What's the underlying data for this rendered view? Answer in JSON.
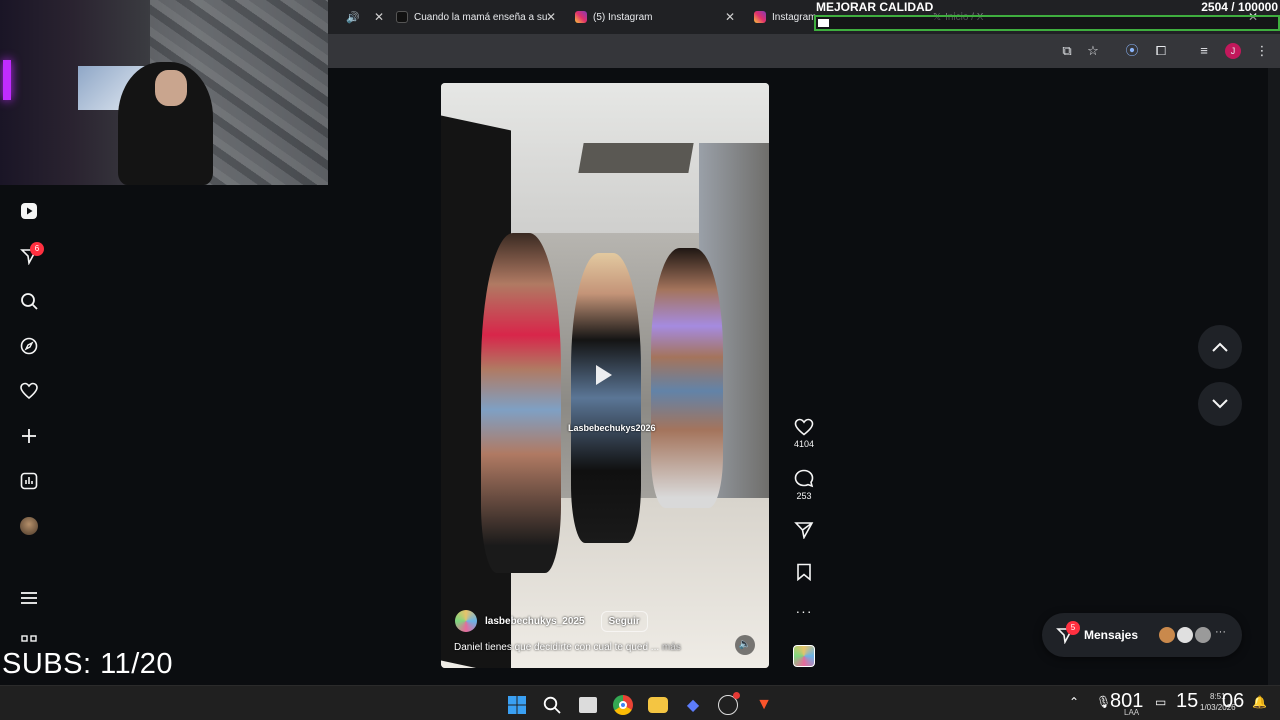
{
  "stream_overlay": {
    "quality_title": "MEJORAR CALIDAD",
    "goal_count": "2504  / 100000",
    "goal_progress": 0.025,
    "subs_text": "SUBS: 11/20"
  },
  "browser": {
    "tabs": [
      {
        "label": "",
        "active": true
      },
      {
        "label": "Cuando la mamá enseña a su",
        "icon": "tiktok-icon"
      },
      {
        "label": "(5) Instagram",
        "icon": "instagram-icon"
      },
      {
        "label": "Instagram",
        "icon": "instagram-icon"
      },
      {
        "label": "Inicio / X",
        "icon": "x-icon"
      }
    ]
  },
  "sidebar": {
    "notifications_badge": "6",
    "items": [
      {
        "name": "reels-icon"
      },
      {
        "name": "messenger-icon"
      },
      {
        "name": "search-icon"
      },
      {
        "name": "explore-icon"
      },
      {
        "name": "heart-icon"
      },
      {
        "name": "create-icon"
      },
      {
        "name": "dashboard-icon"
      },
      {
        "name": "profile-avatar"
      },
      {
        "name": "menu-icon"
      },
      {
        "name": "apps-icon"
      }
    ]
  },
  "reel": {
    "tag_text": "Lasbebechukys2026",
    "username": "lasbebechukys_2025",
    "follow_label": "Seguir",
    "caption": "Daniel tienes que decidirte con cual te qued ...",
    "caption_more": "más",
    "likes": "4104",
    "comments": "253"
  },
  "messages": {
    "label": "Mensajes",
    "badge": "5"
  },
  "taskbar": {
    "clock_big_left": "801",
    "clock_big_mid": "15",
    "clock_big_right": "06",
    "clock_small_time": "8:51",
    "clock_small_date": "1/03/2026",
    "keyboard_layout": "LAA"
  },
  "colors": {
    "accent_green": "#3fae3f",
    "badge_red": "#ff3040",
    "page_bg": "#0b0d10"
  }
}
